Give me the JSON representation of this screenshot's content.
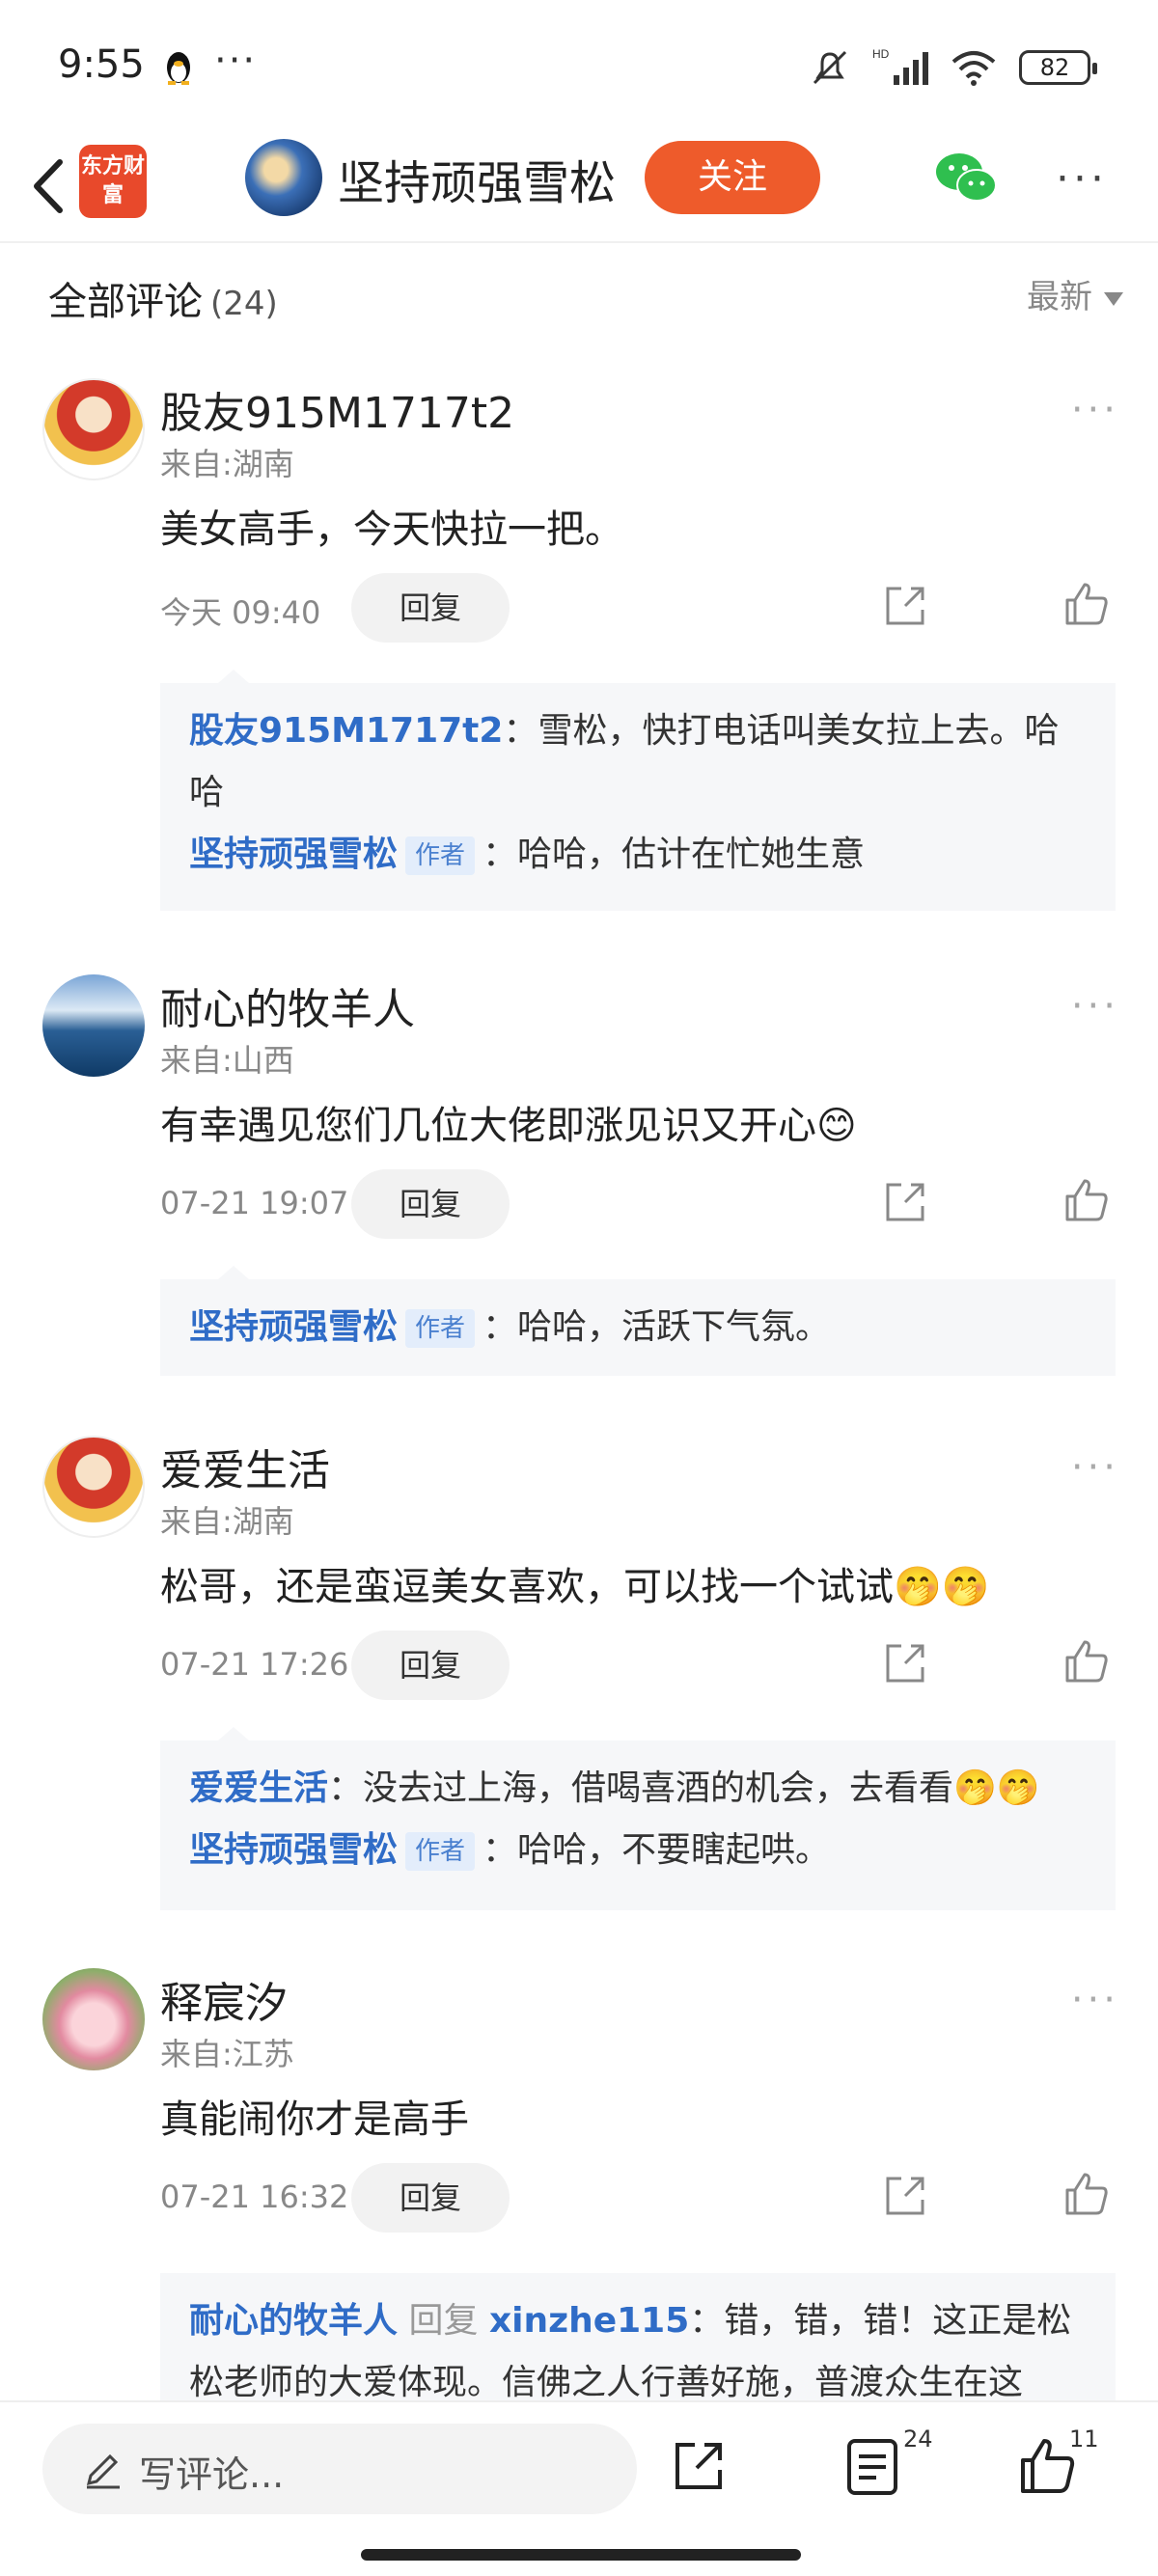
{
  "status_bar": {
    "time": "9:55",
    "battery": "82"
  },
  "header": {
    "back_icon": "back-chevron",
    "logo_text": "东方财富",
    "user_name": "坚持顽强雪松",
    "follow_label": "关注"
  },
  "comments_header": {
    "title": "全部评论",
    "count": "(24)",
    "sort_label": "最新"
  },
  "comments": [
    {
      "user": "股友915M1717t2",
      "from": "来自:湖南",
      "text": "美女高手，今天快拉一把。",
      "time": "今天 09:40",
      "reply_label": "回复",
      "replies": [
        {
          "name": "股友915M1717t2",
          "is_author": false,
          "text": "：雪松，快打电话叫美女拉上去。哈",
          "text2": "哈"
        },
        {
          "name": "坚持顽强雪松",
          "is_author": true,
          "author_tag": "作者",
          "text": "：哈哈，估计在忙她生意"
        }
      ]
    },
    {
      "user": "耐心的牧羊人",
      "from": "来自:山西",
      "text": "有幸遇见您们几位大佬即涨见识又开心😊",
      "time": "07-21 19:07",
      "reply_label": "回复",
      "replies": [
        {
          "name": "坚持顽强雪松",
          "is_author": true,
          "author_tag": "作者",
          "text": "：哈哈，活跃下气氛。"
        }
      ]
    },
    {
      "user": "爱爱生活",
      "from": "来自:湖南",
      "text": "松哥，还是蛮逗美女喜欢，可以找一个试试🤭🤭",
      "time": "07-21 17:26",
      "reply_label": "回复",
      "replies": [
        {
          "name": "爱爱生活",
          "is_author": false,
          "text": "：没去过上海，借喝喜酒的机会，去看看🤭🤭"
        },
        {
          "name": "坚持顽强雪松",
          "is_author": true,
          "author_tag": "作者",
          "text": "：哈哈，不要瞎起哄。"
        }
      ]
    },
    {
      "user": "释宸汐",
      "from": "来自:江苏",
      "text": "真能闹你才是高手",
      "time": "07-21 16:32",
      "reply_label": "回复",
      "replies": [
        {
          "name": "耐心的牧羊人",
          "reply_word": "回复",
          "target": "xinzhe115",
          "text": "：错，错，错！这正是松",
          "text2": "松老师的大爱体现。信佛之人行善好施，普渡众生在这"
        }
      ]
    }
  ],
  "bottom_bar": {
    "input_placeholder": "写评论...",
    "comment_count": "24",
    "like_count": "11"
  }
}
